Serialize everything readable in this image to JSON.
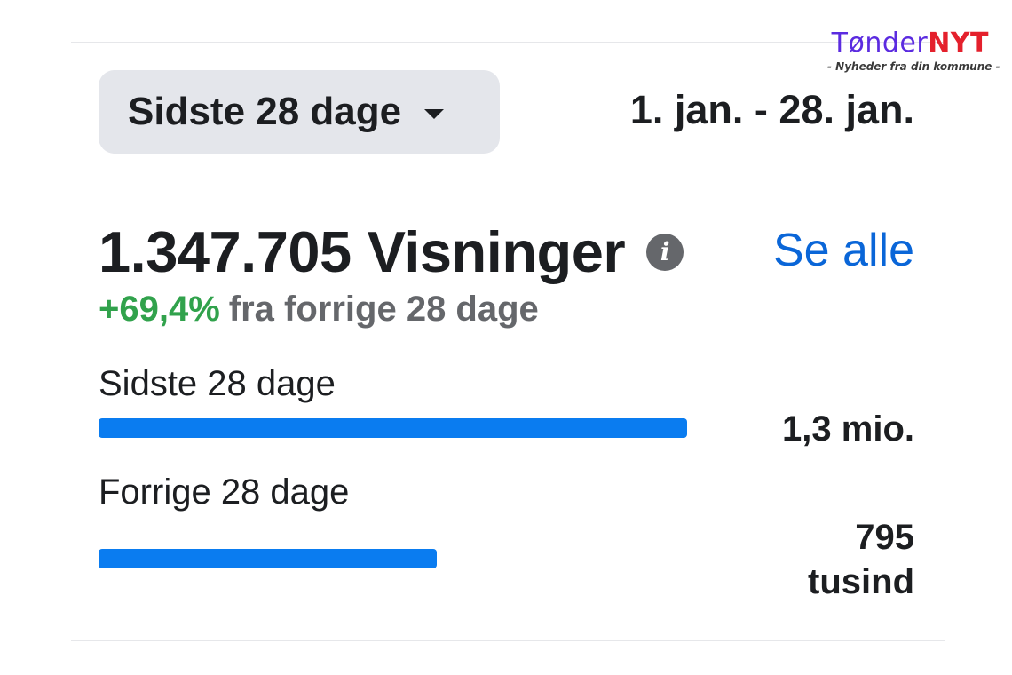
{
  "watermark": {
    "logo_part1": "Tønder",
    "logo_part2": "NYT",
    "tagline": "- Nyheder fra din kommune -"
  },
  "period_selector": {
    "label": "Sidste 28 dage",
    "icon": "caret-down-icon"
  },
  "date_range": "1. jan. - 28. jan.",
  "metric": {
    "value": "1.347.705",
    "label": "Visninger",
    "info_icon": "info-icon",
    "see_all": "Se alle",
    "change_pct": "+69,4%",
    "change_text": "fra forrige 28 dage"
  },
  "comparison": [
    {
      "label": "Sidste 28 dage",
      "value_text": "1,3 mio.",
      "value": 1347705,
      "fill_fraction": 1.0
    },
    {
      "label": "Forrige 28 dage",
      "value_text_line1": "795",
      "value_text_line2": "tusind",
      "value": 795000,
      "fill_fraction": 0.574
    }
  ],
  "colors": {
    "accent_link": "#0a66d8",
    "bar": "#0a7cf0",
    "positive": "#31a24c",
    "muted_text": "#65676b",
    "selector_bg": "#e4e6eb",
    "logo_primary": "#5b2be0",
    "logo_secondary": "#e4202c"
  }
}
